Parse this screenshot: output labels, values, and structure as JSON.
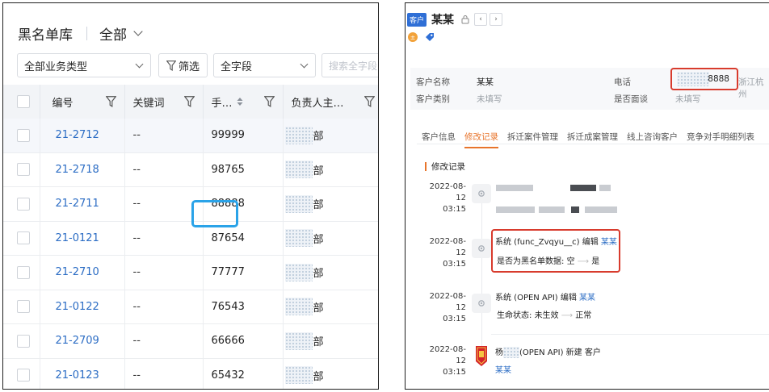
{
  "left": {
    "title": "黑名单库",
    "view": "全部",
    "filters": {
      "business_type": "全部业务类型",
      "filter_btn": "筛选",
      "field": "全字段",
      "search_placeholder": "搜索全字段"
    },
    "columns": {
      "id": "编号",
      "keyword": "关键词",
      "phone": "手…",
      "owner": "负责人主…"
    },
    "rows": [
      {
        "id": "21-2712",
        "keyword": "--",
        "phone": "99999",
        "dept": "部"
      },
      {
        "id": "21-2718",
        "keyword": "--",
        "phone": "98765",
        "dept": "部"
      },
      {
        "id": "21-2711",
        "keyword": "--",
        "phone": "88888",
        "dept": "部"
      },
      {
        "id": "21-0121",
        "keyword": "--",
        "phone": "87654",
        "dept": "部"
      },
      {
        "id": "21-2710",
        "keyword": "--",
        "phone": "77777",
        "dept": "部"
      },
      {
        "id": "21-0122",
        "keyword": "--",
        "phone": "76543",
        "dept": "部"
      },
      {
        "id": "21-2709",
        "keyword": "--",
        "phone": "66666",
        "dept": "部"
      },
      {
        "id": "21-0123",
        "keyword": "--",
        "phone": "65432",
        "dept": "部"
      }
    ],
    "highlight_color": "#2aa3e8"
  },
  "right": {
    "tag": "客户",
    "name": "某某",
    "info": {
      "name_label": "客户名称",
      "name_value": "某某",
      "type_label": "客户类别",
      "type_value": "未填写",
      "phone_label": "电话",
      "phone_tail": "8888",
      "city": "浙江杭州",
      "visit_label": "是否面谈",
      "visit_value": "未填写"
    },
    "tabs": [
      "客户信息",
      "修改记录",
      "拆迁案件管理",
      "拆迁成案管理",
      "线上咨询客户",
      "竞争对手明细列表"
    ],
    "active_tab": 1,
    "section_title": "修改记录",
    "events": [
      {
        "date": "2022-08-12",
        "time": "03:15"
      },
      {
        "date": "2022-08-12",
        "time": "03:15",
        "actor": "系统 (func_Zvqyu__c) 编辑",
        "target": "某某",
        "field": "是否为黑名单数据:",
        "from": "空",
        "to": "是"
      },
      {
        "date": "2022-08-12",
        "time": "03:15",
        "actor": "系统 (OPEN API) 编辑",
        "target": "某某",
        "field": "生命状态:",
        "from": "未生效",
        "to": "正常"
      },
      {
        "date": "2022-08-12",
        "time": "03:15",
        "actor_prefix": "杨",
        "actor_suffix": "(OPEN API) 新建 客户",
        "target": "某某"
      }
    ],
    "accent_color": "#e8742b",
    "highlight_color": "#d83b2d"
  }
}
